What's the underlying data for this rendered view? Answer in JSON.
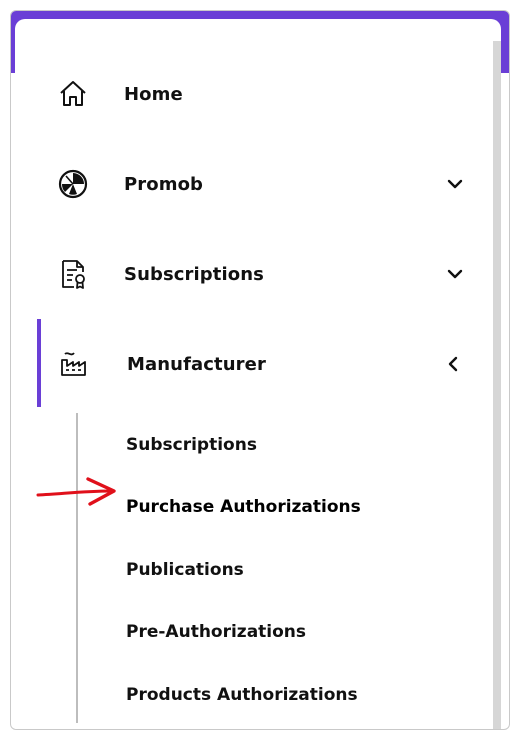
{
  "nav": {
    "items": [
      {
        "label": "Home",
        "icon": "home-icon",
        "has_chevron": false
      },
      {
        "label": "Promob",
        "icon": "promob-icon",
        "has_chevron": true,
        "chevron": "chevron-down-icon"
      },
      {
        "label": "Subscriptions",
        "icon": "document-badge-icon",
        "has_chevron": true,
        "chevron": "chevron-down-icon"
      },
      {
        "label": "Manufacturer",
        "icon": "factory-icon",
        "has_chevron": true,
        "chevron": "chevron-left-icon",
        "active": true
      }
    ]
  },
  "submenu": {
    "items": [
      {
        "label": "Subscriptions"
      },
      {
        "label": "Purchase Authorizations",
        "highlighted": true
      },
      {
        "label": "Publications"
      },
      {
        "label": "Pre-Authorizations"
      },
      {
        "label": "Products Authorizations"
      }
    ]
  },
  "colors": {
    "accent": "#6a3fd6",
    "annotation_arrow": "#e0101a",
    "text": "#111111"
  }
}
